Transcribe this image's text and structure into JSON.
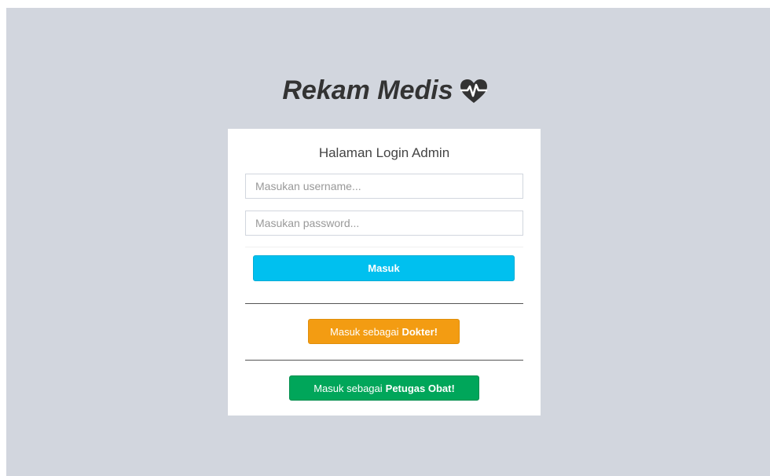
{
  "app": {
    "title": "Rekam Medis",
    "logo_icon": "heartbeat-icon"
  },
  "login_box": {
    "title": "Halaman Login Admin",
    "username": {
      "value": "",
      "placeholder": "Masukan username..."
    },
    "password": {
      "value": "",
      "placeholder": "Masukan password..."
    },
    "submit_label": "Masuk"
  },
  "alt_logins": {
    "dokter": {
      "prefix": "Masuk sebagai",
      "role": "Dokter!"
    },
    "petugas_obat": {
      "prefix": "Masuk sebagai",
      "role": "Petugas Obat!"
    }
  },
  "colors": {
    "background": "#d2d6de",
    "box": "#ffffff",
    "login_button": "#00c0ef",
    "dokter_button": "#f39c12",
    "petugas_button": "#00a65a",
    "logo_text": "#333333"
  }
}
